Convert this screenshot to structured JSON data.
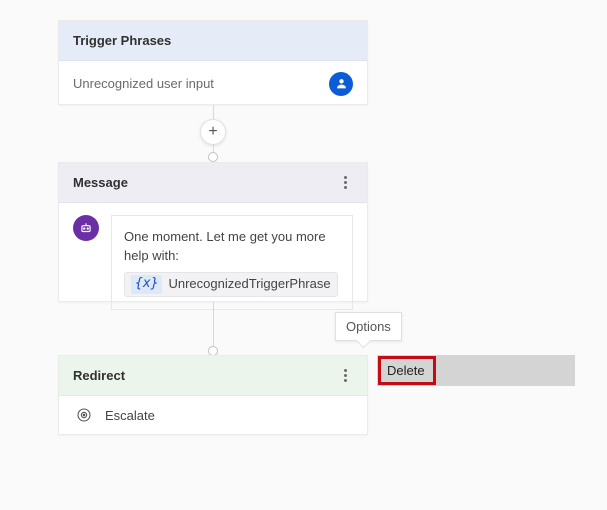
{
  "trigger": {
    "header": "Trigger Phrases",
    "body": "Unrecognized user input"
  },
  "message": {
    "header": "Message",
    "text": "One moment. Let me get you more help with:",
    "var_badge": "{x}",
    "var_name": "UnrecognizedTriggerPhrase"
  },
  "redirect": {
    "header": "Redirect",
    "action": "Escalate"
  },
  "tooltip": {
    "text": "Options"
  },
  "menu": {
    "delete": "Delete"
  },
  "plus": "+"
}
